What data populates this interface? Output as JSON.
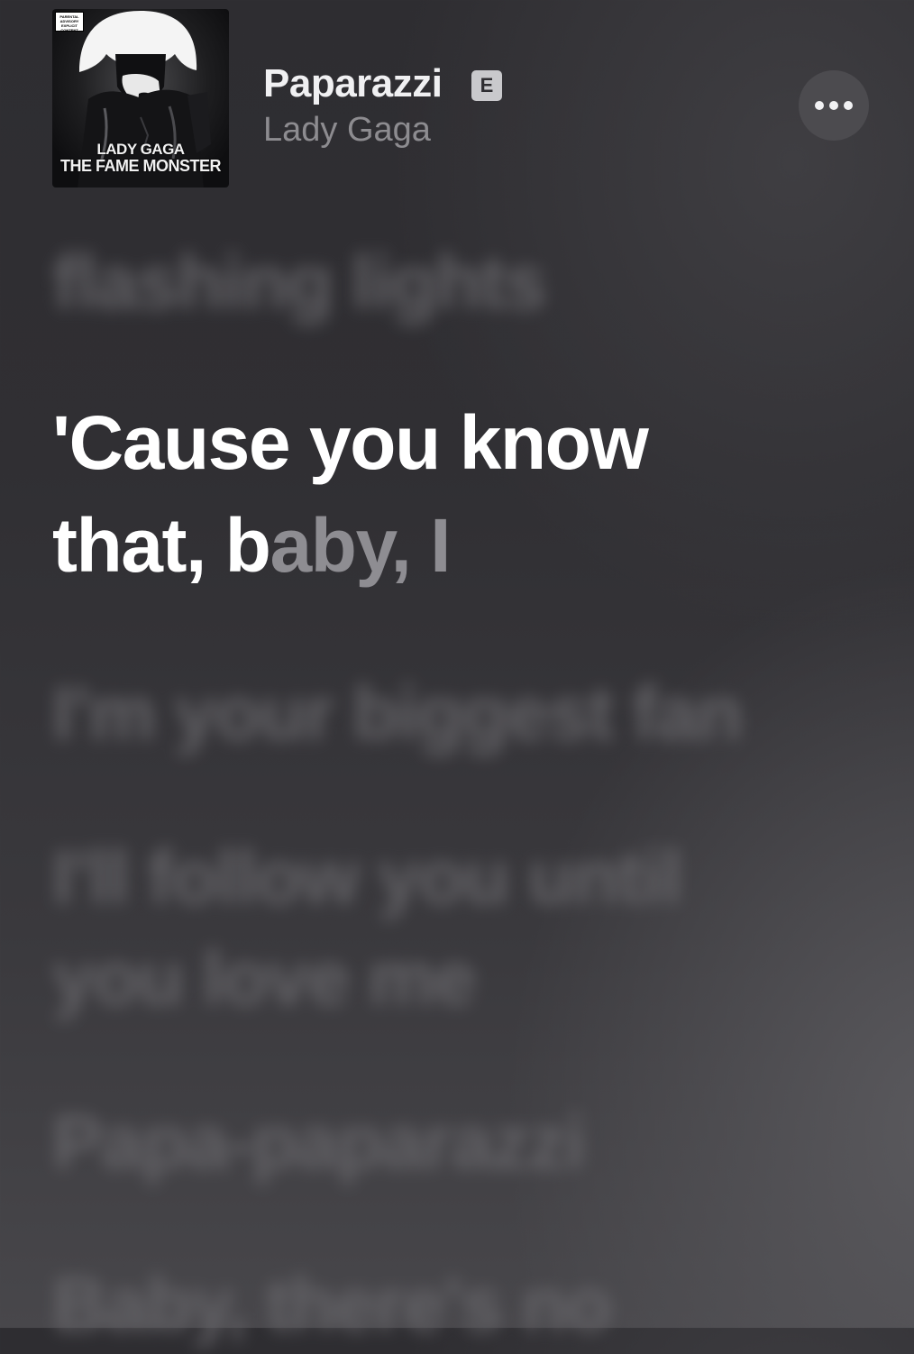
{
  "track": {
    "title": "Paparazzi",
    "explicit_badge": "E",
    "artist": "Lady Gaga",
    "album_art": {
      "artist_text": "LADY GAGA",
      "album_text": "THE FAME MONSTER",
      "parental_label": "PARENTAL ADVISORY EXPLICIT CONTENT"
    }
  },
  "lyrics": {
    "previous": "flashing lights",
    "current_sung": "'Cause you know",
    "current_line2_sung": "that, b",
    "current_line2_pending": "aby, I",
    "next_1": "I'm your biggest fan",
    "next_2_line1": "I'll follow you until",
    "next_2_line2": "you love me",
    "next_3": "Papa-paparazzi",
    "next_4": "Baby, there's no"
  },
  "icons": {
    "more": "ellipsis-icon",
    "explicit": "explicit-badge-icon"
  },
  "colors": {
    "active_lyric": "#ffffff",
    "pending_lyric": "#8e8d92",
    "inactive_lyric": "#6a696d",
    "artist_text": "#8d8c90"
  }
}
